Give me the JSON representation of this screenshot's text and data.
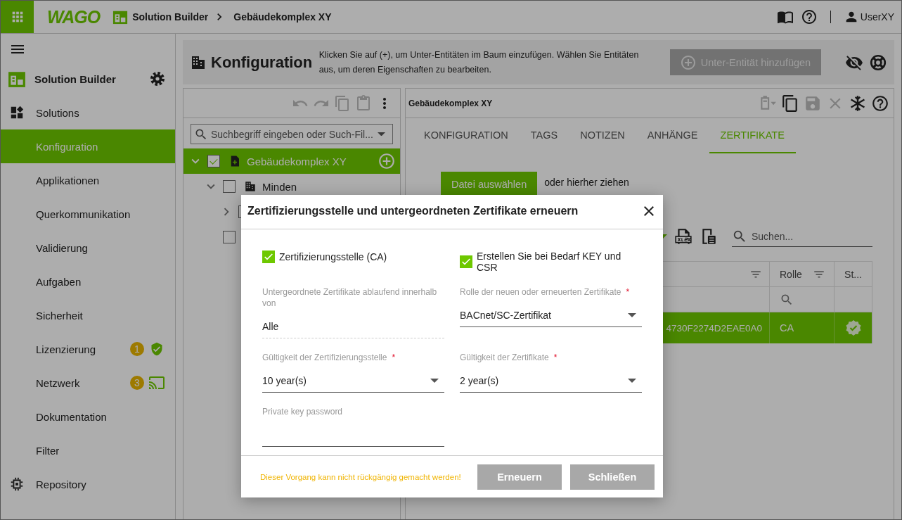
{
  "topbar": {
    "logo": "WAGO",
    "breadcrumb": [
      {
        "label": "Solution Builder",
        "kind": "app"
      },
      {
        "label": "Gebäudekomplex XY",
        "kind": "page"
      }
    ],
    "user": "UserXY"
  },
  "sidebar": {
    "title": "Solution Builder",
    "items": [
      {
        "label": "Solutions",
        "selected": false
      },
      {
        "label": "Konfiguration",
        "selected": true
      },
      {
        "label": "Applikationen",
        "selected": false
      },
      {
        "label": "Querkommunikation",
        "selected": false
      },
      {
        "label": "Validierung",
        "selected": false
      },
      {
        "label": "Aufgaben",
        "selected": false
      },
      {
        "label": "Sicherheit",
        "selected": false
      },
      {
        "label": "Lizenzierung",
        "selected": false,
        "badge": "1"
      },
      {
        "label": "Netzwerk",
        "selected": false,
        "badge": "3"
      },
      {
        "label": "Dokumentation",
        "selected": false
      },
      {
        "label": "Filter",
        "selected": false
      },
      {
        "label": "Repository",
        "selected": false
      }
    ]
  },
  "header": {
    "title": "Konfiguration",
    "description": "Klicken Sie auf (+), um Unter-Entitäten im Baum einzufügen. Wählen Sie Entitäten aus, um deren Eigenschaften zu bearbeiten.",
    "add_button": {
      "label": "Unter-Entität hinzufügen",
      "disabled": true
    }
  },
  "tree": {
    "search_placeholder": "Suchbegriff eingeben oder Such-Fil...",
    "nodes": [
      {
        "label": "Gebäudekomplex XY",
        "selected": true,
        "checked": true,
        "expanded": true,
        "children": [
          {
            "label": "Minden",
            "selected": false,
            "checked": false,
            "expanded": true,
            "children": [
              {
                "selected": false,
                "expanded": false
              }
            ]
          },
          {
            "selected": false,
            "checked": false
          }
        ]
      }
    ]
  },
  "details": {
    "title": "Gebäudekomplex XY",
    "tabs": [
      {
        "label": "KONFIGURATION",
        "selected": false
      },
      {
        "label": "TAGS",
        "selected": false
      },
      {
        "label": "NOTIZEN",
        "selected": false
      },
      {
        "label": "ANHÄNGE",
        "selected": false
      },
      {
        "label": "ZERTIFIKATE",
        "selected": true
      }
    ],
    "upload_button": "Datei auswählen",
    "drop_hint": "oder hierher ziehen",
    "search_placeholder": "Suchen...",
    "table": {
      "columns": [
        {
          "filter": true
        },
        {
          "label": "Rolle",
          "filter": true,
          "search": true
        },
        {
          "label": "St...",
          "filter": false
        }
      ],
      "rows": [
        {
          "cells": [
            "4730F2274D2EAE0A0",
            "CA"
          ],
          "verified": true,
          "selected": true
        }
      ]
    }
  },
  "dialog": {
    "title": "Zertifizierungsstelle und untergeordneten Zertifikate erneuern",
    "checkboxes": [
      {
        "label": "Zertifizierungsstelle (CA)",
        "checked": true
      },
      {
        "label": "Erstellen Sie bei Bedarf KEY und CSR",
        "checked": true
      }
    ],
    "fields": [
      {
        "kind": "readonly",
        "label": "Untergeordnete Zertifikate ablaufend innerhalb von",
        "value": "Alle"
      },
      {
        "kind": "select",
        "label": "Rolle der neuen oder erneuerten Zertifikate",
        "required_mark": "*",
        "value": "BACnet/SC-Zertifikat"
      },
      {
        "kind": "select",
        "label": "Gültigkeit der Zertifizierungsstelle",
        "required_mark": "*",
        "value": "10 year(s)"
      },
      {
        "kind": "select",
        "label": "Gültigkeit der Zertifikate",
        "required_mark": "*",
        "value": "2 year(s)"
      },
      {
        "kind": "password",
        "label": "Private key password"
      }
    ],
    "warning": "Dieser Vorgang kann nicht rückgängig gemacht werden!",
    "buttons": [
      {
        "label": "Erneuern"
      },
      {
        "label": "Schließen"
      }
    ]
  }
}
